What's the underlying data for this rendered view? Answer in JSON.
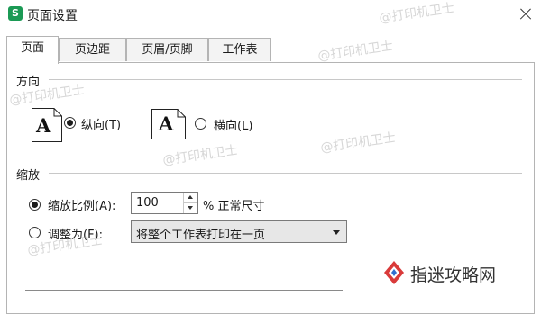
{
  "window": {
    "title": "页面设置",
    "app_icon_letter": "S",
    "accent_color": "#1b9a55"
  },
  "tabs": [
    {
      "label": "页面",
      "active": true
    },
    {
      "label": "页边距",
      "active": false
    },
    {
      "label": "页眉/页脚",
      "active": false
    },
    {
      "label": "工作表",
      "active": false
    }
  ],
  "orientation": {
    "section_label": "方向",
    "paper_letter": "A",
    "options": [
      {
        "label": "纵向(T)",
        "checked": true
      },
      {
        "label": "横向(L)",
        "checked": false
      }
    ]
  },
  "scaling": {
    "section_label": "缩放",
    "scale_label": "缩放比例(A):",
    "scale_value": "100",
    "scale_suffix": "% 正常尺寸",
    "scale_checked": true,
    "fit_label": "调整为(F):",
    "fit_checked": false,
    "fit_select_value": "将整个工作表打印在一页"
  },
  "watermarks": [
    "@打印机卫士",
    "@打印机卫士",
    "@打印机卫士",
    "@打印机卫士",
    "@打印机卫士",
    "@打印机卫士"
  ],
  "brand": {
    "text": "指迷攻略网",
    "logo_color": "#d93a3a",
    "logo_accent": "#2f6fd0"
  }
}
